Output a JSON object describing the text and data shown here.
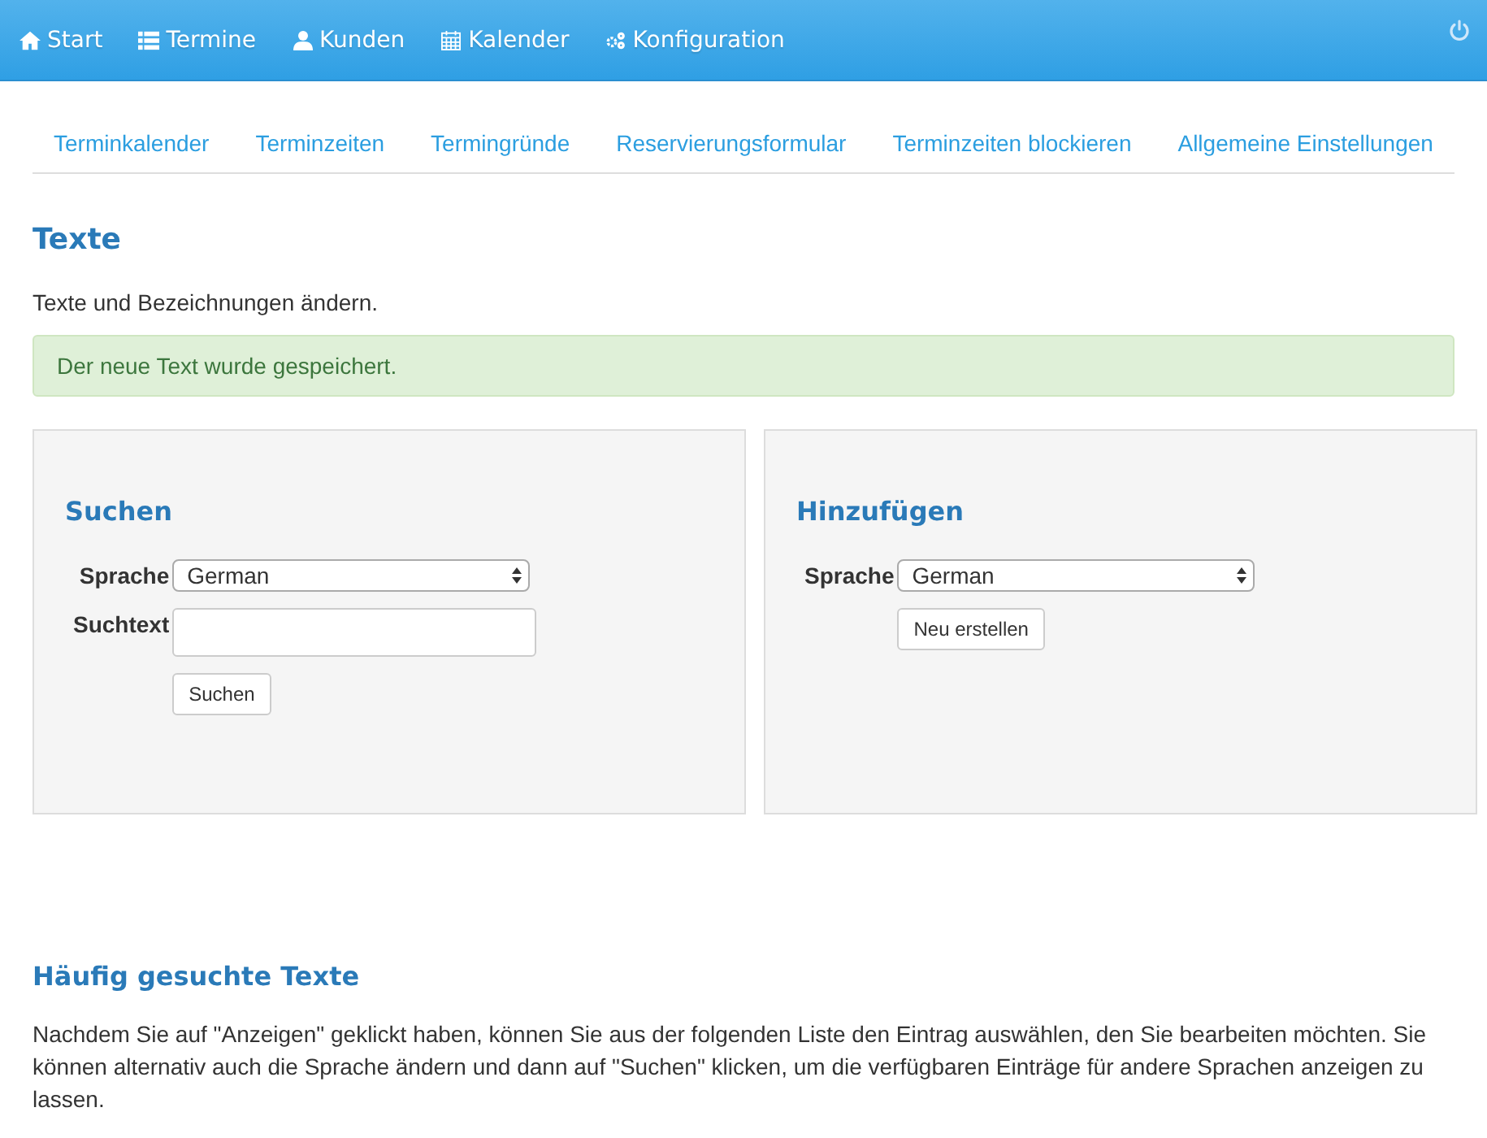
{
  "topnav": {
    "items": [
      {
        "label": "Start"
      },
      {
        "label": "Termine"
      },
      {
        "label": "Kunden"
      },
      {
        "label": "Kalender"
      },
      {
        "label": "Konfiguration"
      }
    ]
  },
  "subnav": [
    "Terminkalender",
    "Terminzeiten",
    "Termingründe",
    "Reservierungsformular",
    "Terminzeiten blockieren",
    "Allgemeine Einstellungen"
  ],
  "title": "Texte",
  "intro": "Texte und Bezeichnungen ändern.",
  "alert": "Der neue Text wurde gespeichert.",
  "panels": [
    {
      "title": "Suchen",
      "fields": [
        {
          "kind": "select",
          "label": "Sprache",
          "value": "German"
        },
        {
          "kind": "text",
          "label": "Suchtext"
        }
      ],
      "button": "Suchen"
    },
    {
      "title": "Hinzufügen",
      "fields": [
        {
          "kind": "select",
          "label": "Sprache",
          "value": "German"
        }
      ],
      "button": "Neu erstellen"
    }
  ],
  "frequent": {
    "title": "Häufig gesuchte Texte",
    "text": "Nachdem Sie auf \"Anzeigen\" geklickt haben, können Sie aus der folgenden Liste den Eintrag auswählen, den Sie bearbeiten möchten. Sie können alternativ auch die Sprache ändern und dann auf \"Suchen\" klicken, um die verfügbaren Einträge für andere Sprachen anzeigen zu lassen."
  }
}
